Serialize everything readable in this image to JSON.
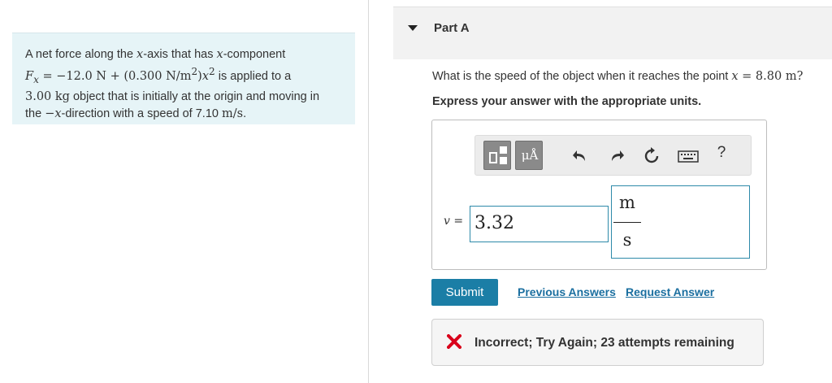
{
  "problem": {
    "line1_text": "A net force along the ",
    "x_var": "x",
    "line1_mid": "-axis that has ",
    "line1_end": "-component",
    "force_expr": "F",
    "force_sub": "x",
    "force_rhs": " = −12.0 N + (0.300 N/m",
    "exp2": "2",
    "force_rhs2": ")",
    "exp2b": "2",
    "line2_end": " is applied to a",
    "mass": "3.00 kg",
    "line3_end": " object that is initially at the origin and moving in",
    "line4_start": "the ",
    "line4_dir": "−x",
    "line4_mid": "-direction with a speed of 7.10 ",
    "speed_unit": "m/s",
    "line4_end": "."
  },
  "part": {
    "title": "Part A",
    "question_start": "What is the speed of the object when it reaches the point ",
    "question_var": "x",
    "question_end": " = 8.80 m?",
    "instruction": "Express your answer with the appropriate units."
  },
  "toolbar": {
    "units_label": "μÅ",
    "help_label": "?"
  },
  "answer": {
    "var": "v",
    "equals": " =",
    "value": "3.32",
    "unit_numerator": "m",
    "unit_denominator": "s"
  },
  "actions": {
    "submit_label": "Submit",
    "previous_answers_label": "Previous Answers",
    "request_answer_label": "Request Answer"
  },
  "feedback": {
    "text": "Incorrect; Try Again; 23 attempts remaining"
  },
  "icons": {
    "caret": "caret-down-icon",
    "templates": "templates-icon",
    "units": "units-icon",
    "undo": "undo-icon",
    "redo": "redo-icon",
    "reset": "reset-icon",
    "keyboard": "keyboard-icon",
    "help": "help-icon",
    "incorrect": "x-mark-icon"
  },
  "colors": {
    "problem_bg": "#e6f4f7",
    "accent_blue": "#1b7ea6",
    "link_blue": "#1b6fa0",
    "input_border": "#2e8aa9",
    "error_red": "#d9001b"
  }
}
